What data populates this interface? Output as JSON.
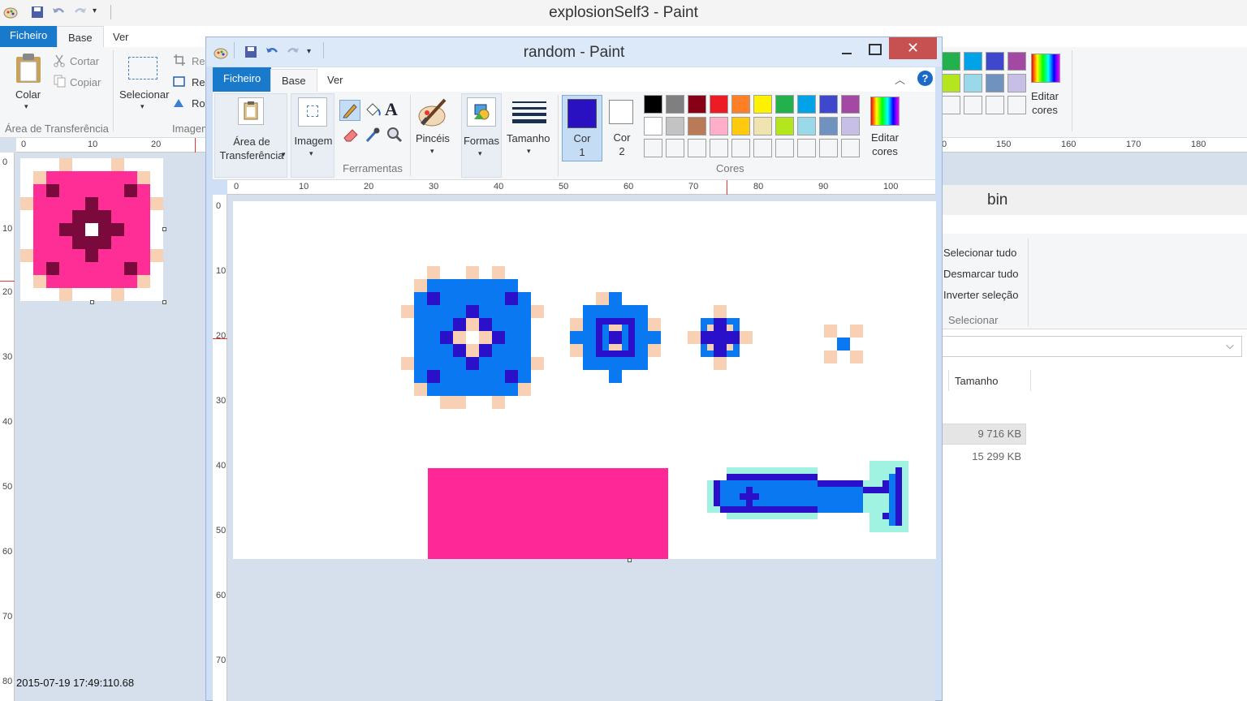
{
  "bg_window": {
    "title": "explosionSelf3 - Paint",
    "tabs": {
      "file": "Ficheiro",
      "home": "Base",
      "view": "Ver"
    },
    "ribbon": {
      "paste_label": "Colar",
      "cut_label": "Cortar",
      "copy_label": "Copiar",
      "clipboard_group": "Área de Transferência",
      "select_label": "Selecionar",
      "image_group": "Imagem",
      "crop_label": "Re",
      "resize_label": "Re",
      "rotate_label": "Ro",
      "edit_colors": "Editar\ncores"
    },
    "ruler_h": [
      "0",
      "10",
      "20"
    ],
    "ruler_h_right": [
      "0",
      "150",
      "160",
      "170",
      "180"
    ],
    "ruler_v": [
      "0",
      "10",
      "20",
      "30",
      "40",
      "50",
      "60",
      "70",
      "80"
    ],
    "timestamp": "2015-07-19 17:49:110.68"
  },
  "explorer": {
    "folder": "bin",
    "select_all": "Selecionar tudo",
    "deselect_all": "Desmarcar tudo",
    "invert_selection": "Inverter seleção",
    "select_group": "Selecionar",
    "size_header": "Tamanho",
    "sizes": [
      "9 716 KB",
      "15 299 KB"
    ]
  },
  "front_window": {
    "title": "random - Paint",
    "tabs": {
      "file": "Ficheiro",
      "home": "Base",
      "view": "Ver"
    },
    "ribbon": {
      "clipboard_label": "Área de\nTransferência",
      "image_label": "Imagem",
      "tools_group": "Ferramentas",
      "brushes_label": "Pincéis",
      "shapes_label": "Formas",
      "size_label": "Tamanho",
      "color1_label": "Cor\n1",
      "color2_label": "Cor\n2",
      "colors_group": "Cores",
      "edit_colors": "Editar\ncores"
    },
    "color1": "#2910c0",
    "color2": "#ffffff",
    "palette_row1": [
      "#000000",
      "#7f7f7f",
      "#880015",
      "#ed1c24",
      "#ff7f27",
      "#fff200",
      "#22b14c",
      "#00a2e8",
      "#3f48cc",
      "#a349a4"
    ],
    "palette_row2": [
      "#ffffff",
      "#c3c3c3",
      "#b97a57",
      "#ffaec9",
      "#ffc90e",
      "#efe4b0",
      "#b5e61d",
      "#99d9ea",
      "#7092be",
      "#c8bfe7"
    ],
    "ruler_h": [
      "0",
      "10",
      "20",
      "30",
      "40",
      "50",
      "60",
      "70",
      "80",
      "90",
      "100"
    ],
    "ruler_v": [
      "0",
      "10",
      "20",
      "30",
      "40",
      "50",
      "60",
      "70"
    ]
  }
}
